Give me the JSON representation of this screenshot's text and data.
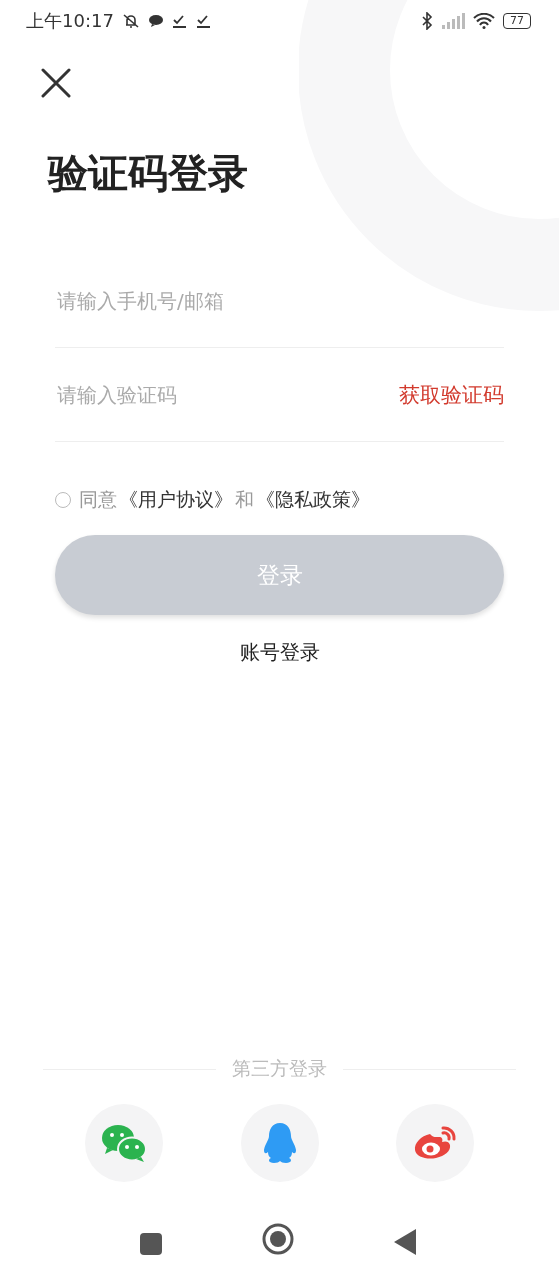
{
  "status_bar": {
    "time": "上午10:17",
    "battery": "77"
  },
  "title": "验证码登录",
  "phone_field": {
    "placeholder": "请输入手机号/邮箱"
  },
  "code_field": {
    "placeholder": "请输入验证码",
    "action": "获取验证码"
  },
  "agreement": {
    "checked": false,
    "parts": [
      {
        "kind": "text",
        "text": "同意"
      },
      {
        "kind": "link",
        "text": "《用户协议》"
      },
      {
        "kind": "text",
        "text": "和"
      },
      {
        "kind": "link",
        "text": "《隐私政策》"
      }
    ]
  },
  "login_button": {
    "label": "登录",
    "disabled": true
  },
  "account_login": "账号登录",
  "third_party": {
    "label": "第三方登录",
    "providers": [
      {
        "kind": "chat"
      },
      {
        "kind": "penguin"
      },
      {
        "kind": "eye"
      }
    ]
  }
}
